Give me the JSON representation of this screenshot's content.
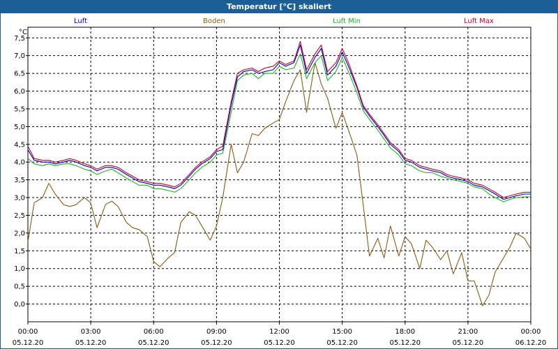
{
  "window": {
    "title": "Temperatur [°C] skaliert"
  },
  "chart_data": {
    "type": "line",
    "title": "Temperatur [°C] skaliert",
    "ylabel": "°C",
    "ylim": [
      -0.5,
      7.8
    ],
    "xlim": [
      0,
      24
    ],
    "grid": true,
    "legend_placement": "top",
    "yticks": [
      "7,5",
      "7,0",
      "6,5",
      "6,0",
      "5,5",
      "5,0",
      "4,5",
      "4,0",
      "3,5",
      "3,0",
      "2,5",
      "2,0",
      "1,5",
      "1,0",
      "0,5",
      "0,0"
    ],
    "ytick_values": [
      7.5,
      7.0,
      6.5,
      6.0,
      5.5,
      5.0,
      4.5,
      4.0,
      3.5,
      3.0,
      2.5,
      2.0,
      1.5,
      1.0,
      0.5,
      0.0
    ],
    "xticks": [
      {
        "time": "00:00",
        "date": "05.12.20"
      },
      {
        "time": "03:00",
        "date": "05.12.20"
      },
      {
        "time": "06:00",
        "date": "05.12.20"
      },
      {
        "time": "09:00",
        "date": "05.12.20"
      },
      {
        "time": "12:00",
        "date": "05.12.20"
      },
      {
        "time": "15:00",
        "date": "05.12.20"
      },
      {
        "time": "18:00",
        "date": "05.12.20"
      },
      {
        "time": "21:00",
        "date": "05.12.20"
      },
      {
        "time": "00:00",
        "date": "06.12.20"
      }
    ],
    "xtick_hours": [
      0,
      3,
      6,
      9,
      12,
      15,
      18,
      21,
      24
    ],
    "series": [
      {
        "name": "Luft",
        "color": "#0000c8",
        "x": [
          0,
          0.3,
          0.7,
          1,
          1.3,
          1.7,
          2,
          2.3,
          2.7,
          3,
          3.3,
          3.7,
          4,
          4.3,
          4.7,
          5,
          5.3,
          5.7,
          6,
          6.3,
          6.7,
          7,
          7.3,
          7.7,
          8,
          8.3,
          8.7,
          9,
          9.3,
          9.7,
          10,
          10.3,
          10.7,
          11,
          11.3,
          11.7,
          12,
          12.3,
          12.7,
          13,
          13.3,
          13.7,
          14,
          14.3,
          14.7,
          15,
          15.3,
          15.7,
          16,
          16.3,
          16.7,
          17,
          17.3,
          17.7,
          18,
          18.3,
          18.7,
          19,
          19.3,
          19.7,
          20,
          20.3,
          20.7,
          21,
          21.3,
          21.7,
          22,
          22.3,
          22.7,
          23,
          23.3,
          23.7,
          24
        ],
        "y": [
          4.35,
          4.05,
          4.0,
          4.0,
          3.95,
          4.0,
          4.05,
          4.0,
          3.9,
          3.85,
          3.75,
          3.85,
          3.85,
          3.8,
          3.65,
          3.55,
          3.45,
          3.4,
          3.35,
          3.35,
          3.3,
          3.25,
          3.35,
          3.6,
          3.8,
          3.95,
          4.1,
          4.3,
          4.35,
          5.6,
          6.4,
          6.55,
          6.6,
          6.5,
          6.55,
          6.6,
          6.8,
          6.7,
          6.8,
          7.3,
          6.5,
          6.95,
          7.2,
          6.45,
          6.7,
          7.1,
          6.7,
          6.1,
          5.55,
          5.3,
          5.0,
          4.75,
          4.5,
          4.3,
          4.05,
          4.0,
          3.85,
          3.8,
          3.75,
          3.7,
          3.6,
          3.55,
          3.5,
          3.45,
          3.35,
          3.3,
          3.2,
          3.1,
          2.95,
          3.0,
          3.05,
          3.1,
          3.1
        ]
      },
      {
        "name": "Boden",
        "color": "#8b5a14",
        "x": [
          0,
          0.3,
          0.7,
          1,
          1.3,
          1.7,
          2,
          2.3,
          2.7,
          3,
          3.3,
          3.7,
          4,
          4.3,
          4.7,
          5,
          5.3,
          5.7,
          6,
          6.3,
          6.7,
          7,
          7.3,
          7.7,
          8,
          8.3,
          8.7,
          9,
          9.3,
          9.7,
          10,
          10.3,
          10.7,
          11,
          11.3,
          11.7,
          12,
          12.3,
          12.7,
          13,
          13.3,
          13.7,
          14,
          14.3,
          14.7,
          15,
          15.3,
          15.7,
          16,
          16.3,
          16.7,
          17,
          17.3,
          17.7,
          18,
          18.3,
          18.7,
          19,
          19.3,
          19.7,
          20,
          20.3,
          20.7,
          21,
          21.3,
          21.7,
          22,
          22.3,
          22.7,
          23,
          23.3,
          23.7,
          24
        ],
        "y": [
          1.75,
          2.85,
          3.0,
          3.4,
          3.1,
          2.8,
          2.75,
          2.8,
          3.0,
          2.85,
          2.15,
          2.8,
          2.9,
          2.75,
          2.3,
          2.15,
          2.1,
          1.9,
          1.2,
          1.05,
          1.3,
          1.45,
          2.3,
          2.6,
          2.5,
          2.2,
          1.8,
          2.2,
          3.0,
          4.5,
          3.7,
          4.0,
          4.8,
          4.75,
          4.95,
          5.1,
          5.2,
          5.7,
          6.3,
          6.6,
          5.4,
          6.8,
          6.2,
          5.8,
          4.95,
          5.4,
          4.9,
          4.2,
          2.8,
          1.35,
          1.85,
          1.3,
          2.2,
          1.35,
          1.9,
          1.7,
          1.0,
          1.8,
          1.6,
          1.25,
          1.5,
          0.85,
          1.45,
          0.65,
          0.65,
          -0.05,
          0.25,
          0.9,
          1.3,
          1.6,
          2.0,
          1.85,
          1.55
        ]
      },
      {
        "name": "Luft Min",
        "color": "#1eb41e",
        "x": [
          0,
          0.3,
          0.7,
          1,
          1.3,
          1.7,
          2,
          2.3,
          2.7,
          3,
          3.3,
          3.7,
          4,
          4.3,
          4.7,
          5,
          5.3,
          5.7,
          6,
          6.3,
          6.7,
          7,
          7.3,
          7.7,
          8,
          8.3,
          8.7,
          9,
          9.3,
          9.7,
          10,
          10.3,
          10.7,
          11,
          11.3,
          11.7,
          12,
          12.3,
          12.7,
          13,
          13.3,
          13.7,
          14,
          14.3,
          14.7,
          15,
          15.3,
          15.7,
          16,
          16.3,
          16.7,
          17,
          17.3,
          17.7,
          18,
          18.3,
          18.7,
          19,
          19.3,
          19.7,
          20,
          20.3,
          20.7,
          21,
          21.3,
          21.7,
          22,
          22.3,
          22.7,
          23,
          23.3,
          23.7,
          24
        ],
        "y": [
          4.1,
          3.95,
          3.9,
          3.95,
          3.9,
          3.95,
          3.95,
          3.9,
          3.8,
          3.75,
          3.65,
          3.75,
          3.8,
          3.7,
          3.55,
          3.45,
          3.35,
          3.35,
          3.25,
          3.25,
          3.2,
          3.15,
          3.25,
          3.5,
          3.7,
          3.85,
          4.0,
          4.2,
          4.25,
          5.4,
          6.3,
          6.45,
          6.5,
          6.35,
          6.5,
          6.5,
          6.7,
          6.6,
          6.65,
          7.05,
          6.35,
          6.8,
          7.0,
          6.3,
          6.55,
          6.95,
          6.55,
          5.95,
          5.45,
          5.2,
          4.9,
          4.65,
          4.4,
          4.2,
          3.95,
          3.9,
          3.75,
          3.7,
          3.7,
          3.6,
          3.55,
          3.5,
          3.45,
          3.4,
          3.3,
          3.25,
          3.1,
          3.0,
          2.88,
          2.95,
          3.0,
          3.02,
          3.02
        ]
      },
      {
        "name": "Luft Max",
        "color": "#c80028",
        "x": [
          0,
          0.3,
          0.7,
          1,
          1.3,
          1.7,
          2,
          2.3,
          2.7,
          3,
          3.3,
          3.7,
          4,
          4.3,
          4.7,
          5,
          5.3,
          5.7,
          6,
          6.3,
          6.7,
          7,
          7.3,
          7.7,
          8,
          8.3,
          8.7,
          9,
          9.3,
          9.7,
          10,
          10.3,
          10.7,
          11,
          11.3,
          11.7,
          12,
          12.3,
          12.7,
          13,
          13.3,
          13.7,
          14,
          14.3,
          14.7,
          15,
          15.3,
          15.7,
          16,
          16.3,
          16.7,
          17,
          17.3,
          17.7,
          18,
          18.3,
          18.7,
          19,
          19.3,
          19.7,
          20,
          20.3,
          20.7,
          21,
          21.3,
          21.7,
          22,
          22.3,
          22.7,
          23,
          23.3,
          23.7,
          24
        ],
        "y": [
          4.45,
          4.1,
          4.05,
          4.05,
          4.0,
          4.05,
          4.1,
          4.05,
          3.95,
          3.9,
          3.8,
          3.9,
          3.9,
          3.85,
          3.7,
          3.6,
          3.5,
          3.45,
          3.4,
          3.4,
          3.35,
          3.3,
          3.4,
          3.65,
          3.85,
          4.0,
          4.15,
          4.35,
          4.45,
          5.7,
          6.5,
          6.6,
          6.65,
          6.55,
          6.65,
          6.7,
          6.85,
          6.75,
          6.85,
          7.4,
          6.6,
          7.05,
          7.3,
          6.55,
          6.8,
          7.2,
          6.8,
          6.15,
          5.6,
          5.35,
          5.05,
          4.8,
          4.55,
          4.35,
          4.1,
          4.05,
          3.9,
          3.85,
          3.8,
          3.75,
          3.65,
          3.6,
          3.55,
          3.5,
          3.4,
          3.35,
          3.25,
          3.15,
          3.0,
          3.05,
          3.1,
          3.15,
          3.15
        ]
      }
    ]
  }
}
